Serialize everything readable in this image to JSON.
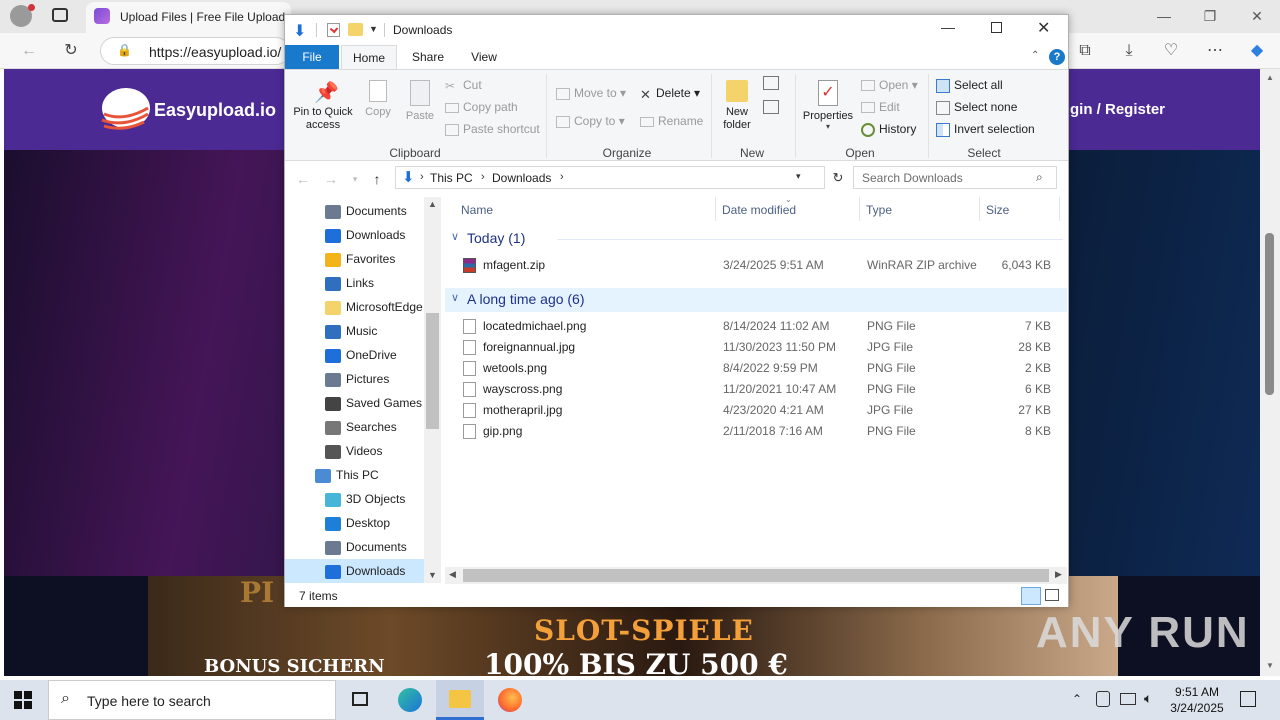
{
  "browser": {
    "tab_title": "Upload Files | Free File Upload a",
    "url": "https://easyupload.io/"
  },
  "page": {
    "logo_text": "Easyupload.io",
    "login_link": "gin / Register",
    "ad": {
      "top_text": "PI",
      "headline": "SLOT-SPIELE",
      "offer": "100% BIS ZU 500 €",
      "cta": "BONUS SICHERN"
    },
    "watermark": "ANY RUN"
  },
  "explorer": {
    "title": "Downloads",
    "tabs": [
      "File",
      "Home",
      "Share",
      "View"
    ],
    "ribbon": {
      "clipboard": {
        "label": "Clipboard",
        "pin": "Pin to Quick access",
        "copy": "Copy",
        "paste": "Paste",
        "cut": "Cut",
        "copy_path": "Copy path",
        "paste_shortcut": "Paste shortcut"
      },
      "organize": {
        "label": "Organize",
        "move_to": "Move to",
        "copy_to": "Copy to",
        "delete": "Delete",
        "rename": "Rename"
      },
      "new": {
        "label": "New",
        "new_folder": "New folder"
      },
      "open": {
        "label": "Open",
        "properties": "Properties",
        "open": "Open",
        "edit": "Edit",
        "history": "History"
      },
      "select": {
        "label": "Select",
        "select_all": "Select all",
        "select_none": "Select none",
        "invert_selection": "Invert selection"
      }
    },
    "breadcrumb": [
      "This PC",
      "Downloads"
    ],
    "search_placeholder": "Search Downloads",
    "nav_items": [
      {
        "label": "Documents",
        "indent": 1
      },
      {
        "label": "Downloads",
        "indent": 1
      },
      {
        "label": "Favorites",
        "indent": 1
      },
      {
        "label": "Links",
        "indent": 1
      },
      {
        "label": "MicrosoftEdge",
        "indent": 1
      },
      {
        "label": "Music",
        "indent": 1
      },
      {
        "label": "OneDrive",
        "indent": 1
      },
      {
        "label": "Pictures",
        "indent": 1
      },
      {
        "label": "Saved Games",
        "indent": 1
      },
      {
        "label": "Searches",
        "indent": 1
      },
      {
        "label": "Videos",
        "indent": 1
      },
      {
        "label": "This PC",
        "indent": 0
      },
      {
        "label": "3D Objects",
        "indent": 1
      },
      {
        "label": "Desktop",
        "indent": 1
      },
      {
        "label": "Documents",
        "indent": 1
      },
      {
        "label": "Downloads",
        "indent": 1,
        "selected": true
      }
    ],
    "columns": {
      "name": "Name",
      "date": "Date modified",
      "type": "Type",
      "size": "Size"
    },
    "groups": [
      {
        "title": "Today (1)",
        "files": [
          {
            "name": "mfagent.zip",
            "date": "3/24/2025 9:51 AM",
            "type": "WinRAR ZIP archive",
            "size": "6,043 KB"
          }
        ]
      },
      {
        "title": "A long time ago (6)",
        "files": [
          {
            "name": "locatedmichael.png",
            "date": "8/14/2024 11:02 AM",
            "type": "PNG File",
            "size": "7 KB"
          },
          {
            "name": "foreignannual.jpg",
            "date": "11/30/2023 11:50 PM",
            "type": "JPG File",
            "size": "28 KB"
          },
          {
            "name": "wetools.png",
            "date": "8/4/2022 9:59 PM",
            "type": "PNG File",
            "size": "2 KB"
          },
          {
            "name": "wayscross.png",
            "date": "11/20/2021 10:47 AM",
            "type": "PNG File",
            "size": "6 KB"
          },
          {
            "name": "motherapril.jpg",
            "date": "4/23/2020 4:21 AM",
            "type": "JPG File",
            "size": "27 KB"
          },
          {
            "name": "gip.png",
            "date": "2/11/2018 7:16 AM",
            "type": "PNG File",
            "size": "8 KB"
          }
        ]
      }
    ],
    "status": "7 items"
  },
  "taskbar": {
    "search_placeholder": "Type here to search",
    "time": "9:51 AM",
    "date": "3/24/2025"
  }
}
